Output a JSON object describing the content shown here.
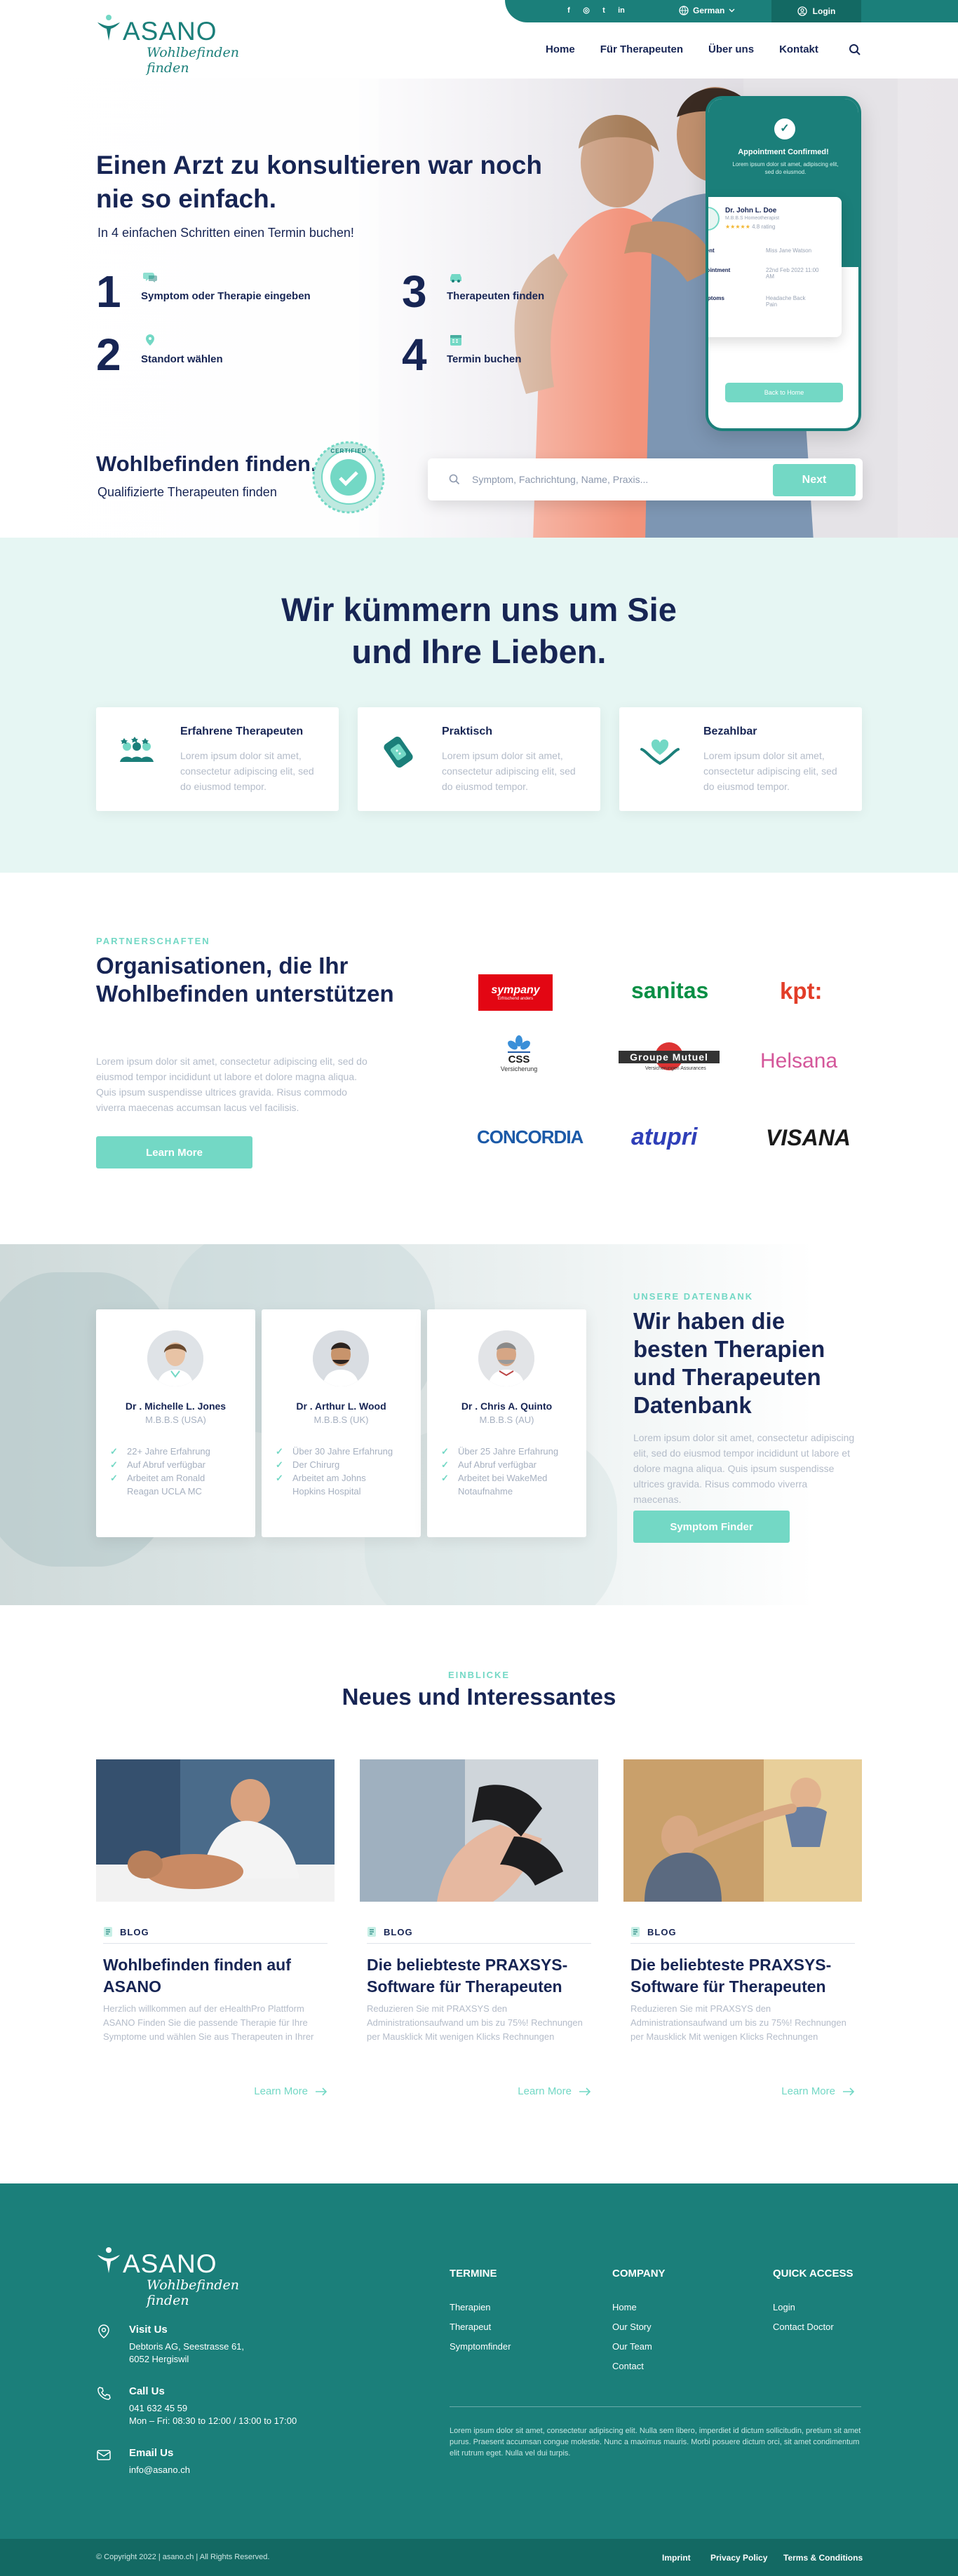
{
  "topbar": {
    "social": [
      "f",
      "◎",
      "t",
      "in"
    ],
    "language": "German",
    "login": "Login"
  },
  "brand": {
    "name": "ASANO",
    "tagline": "Wohlbefinden finden",
    "reg": "®"
  },
  "nav": [
    "Home",
    "Für Therapeuten",
    "Über uns",
    "Kontakt"
  ],
  "hero": {
    "title": "Einen Arzt zu konsultieren war noch nie so einfach.",
    "subtitle": "In 4 einfachen Schritten einen Termin buchen!",
    "steps": [
      {
        "num": "1",
        "label": "Symptom oder Therapie eingeben",
        "icon": "chat-icon"
      },
      {
        "num": "2",
        "label": "Standort wählen",
        "icon": "location-icon"
      },
      {
        "num": "3",
        "label": "Therapeuten finden",
        "icon": "car-icon"
      },
      {
        "num": "4",
        "label": "Termin buchen",
        "icon": "calendar-icon"
      }
    ],
    "tagline_title": "Wohlbefinden finden.",
    "tagline_sub": "Qualifizierte Therapeuten finden",
    "badge_text": "CERTIFIED",
    "search_placeholder": "Symptom, Fachrichtung, Name, Praxis...",
    "search_button": "Next",
    "phone": {
      "confirm_title": "Appointment Confirmed!",
      "confirm_sub": "Lorem ipsum dolor sit amet, adipiscing elit, sed do eiusmod.",
      "doctor": "Dr. John L. Doe",
      "doctor_role": "M.B.B.S Homeotherapist",
      "rating": "4.8 rating",
      "rows": [
        {
          "k": "Patient",
          "v": "Miss Jane Watson"
        },
        {
          "k": "Appointment",
          "v": "22nd Feb 2022 11:00 AM"
        },
        {
          "k": "Symptoms",
          "v": "Headache Back Pain"
        }
      ],
      "button": "Back to Home"
    }
  },
  "care": {
    "title_line1": "Wir kümmern uns um Sie",
    "title_line2": "und Ihre Lieben.",
    "cards": [
      {
        "title": "Erfahrene Therapeuten",
        "desc": "Lorem ipsum dolor sit amet, consectetur adipiscing elit, sed do eiusmod tempor.",
        "icon": "team-icon"
      },
      {
        "title": "Praktisch",
        "desc": "Lorem ipsum dolor sit amet, consectetur adipiscing elit, sed do eiusmod tempor.",
        "icon": "bandage-icon"
      },
      {
        "title": "Bezahlbar",
        "desc": "Lorem ipsum dolor sit amet, consectetur adipiscing elit, sed do eiusmod tempor.",
        "icon": "heart-hands-icon"
      }
    ]
  },
  "partners": {
    "eyebrow": "PARTNERSCHAFTEN",
    "title": "Organisationen, die Ihr Wohlbefinden unterstützen",
    "desc": "Lorem ipsum dolor sit amet, consectetur adipiscing elit, sed do eiusmod tempor incididunt ut labore et dolore magna aliqua. Quis ipsum suspendisse ultrices gravida. Risus commodo viverra maecenas accumsan lacus vel facilisis.",
    "button": "Learn More",
    "logos": [
      "sympany",
      "sanitas",
      "kpt:",
      "CSS",
      "Groupe Mutuel",
      "Helsana",
      "CONCORDIA",
      "atupri",
      "VISANA"
    ],
    "css_sub": "Versicherung",
    "sympany_sub": "Erfrischend anders",
    "gm_sub": "Versicherungen Assurances",
    "colors": {
      "sympany": "#e30613",
      "sanitas": "#0a8f45",
      "kpt": "#e23d28",
      "css": "#1f5aa6",
      "helsana": "#d4579a",
      "concordia": "#1c5aa8",
      "atupri": "#2f3fb8",
      "visana": "#1a1a1a"
    }
  },
  "doctors": {
    "eyebrow": "UNSERE DATENBANK",
    "title": "Wir haben die besten Therapien und Therapeuten Datenbank",
    "desc": "Lorem ipsum dolor sit amet, consectetur adipiscing elit, sed do eiusmod tempor incididunt ut labore et dolore magna aliqua. Quis ipsum suspendisse ultrices gravida. Risus commodo viverra maecenas.",
    "button": "Symptom Finder",
    "list": [
      {
        "name": "Dr . Michelle L. Jones",
        "qual": "M.B.B.S (USA)",
        "points": [
          "22+ Jahre Erfahrung",
          "Auf Abruf verfügbar",
          "Arbeitet am Ronald Reagan UCLA MC"
        ]
      },
      {
        "name": "Dr . Arthur L. Wood",
        "qual": "M.B.B.S (UK)",
        "points": [
          "Über 30 Jahre Erfahrung",
          "Der Chirurg",
          "Arbeitet am Johns Hopkins Hospital"
        ]
      },
      {
        "name": "Dr . Chris A. Quinto",
        "qual": "M.B.B.S (AU)",
        "points": [
          "Über 25 Jahre Erfahrung",
          "Auf Abruf verfügbar",
          "Arbeitet bei WakeMed Notaufnahme"
        ]
      }
    ]
  },
  "news": {
    "eyebrow": "EINBLICKE",
    "title": "Neues und Interessantes",
    "posts": [
      {
        "tag": "BLOG",
        "title": "Wohlbefinden finden auf ASANO",
        "desc": "Herzlich willkommen auf der eHealthPro Plattform ASANO Finden Sie die passende Therapie für Ihre Symptome und wählen Sie aus Therapeuten in Ihrer",
        "more": "Learn More"
      },
      {
        "tag": "BLOG",
        "title": "Die beliebteste PRAXSYS-Software für Therapeuten",
        "desc": "Reduzieren Sie mit PRAXSYS den Administrationsaufwand um bis zu 75%! Rechnungen per Mausklick Mit wenigen Klicks Rechnungen",
        "more": "Learn More"
      },
      {
        "tag": "BLOG",
        "title": "Die beliebteste PRAXSYS-Software für Therapeuten",
        "desc": "Reduzieren Sie mit PRAXSYS den Administrationsaufwand um bis zu 75%! Rechnungen per Mausklick Mit wenigen Klicks Rechnungen",
        "more": "Learn More"
      }
    ]
  },
  "footer": {
    "visit_title": "Visit Us",
    "visit_l1": "Debtoris AG, Seestrasse 61,",
    "visit_l2": "6052 Hergiswil",
    "call_title": "Call Us",
    "call_l1": "041 632 45 59",
    "call_l2": "Mon – Fri: 08:30 to 12:00 / 13:00 to 17:00",
    "email_title": "Email Us",
    "email_l1": "info@asano.ch",
    "cols": [
      {
        "title": "TERMINE",
        "links": [
          "Therapien",
          "Therapeut",
          "Symptomfinder"
        ]
      },
      {
        "title": "COMPANY",
        "links": [
          "Home",
          "Our Story",
          "Our Team",
          "Contact"
        ]
      },
      {
        "title": "QUICK ACCESS",
        "links": [
          "Login",
          "Contact Doctor"
        ]
      }
    ],
    "para": "Lorem ipsum dolor sit amet, consectetur adipiscing elit. Nulla sem libero, imperdiet id dictum sollicitudin, pretium sit amet purus. Praesent accumsan congue molestie. Nunc a maximus mauris. Morbi posuere dictum orci, sit amet condimentum elit rutrum eget. Nulla vel dui turpis.",
    "copyright": "© Copyright 2022   |   asano.ch   |   All Rights Reserved.",
    "bottom_links": [
      "Imprint",
      "Privacy Policy",
      "Terms & Conditions"
    ]
  }
}
